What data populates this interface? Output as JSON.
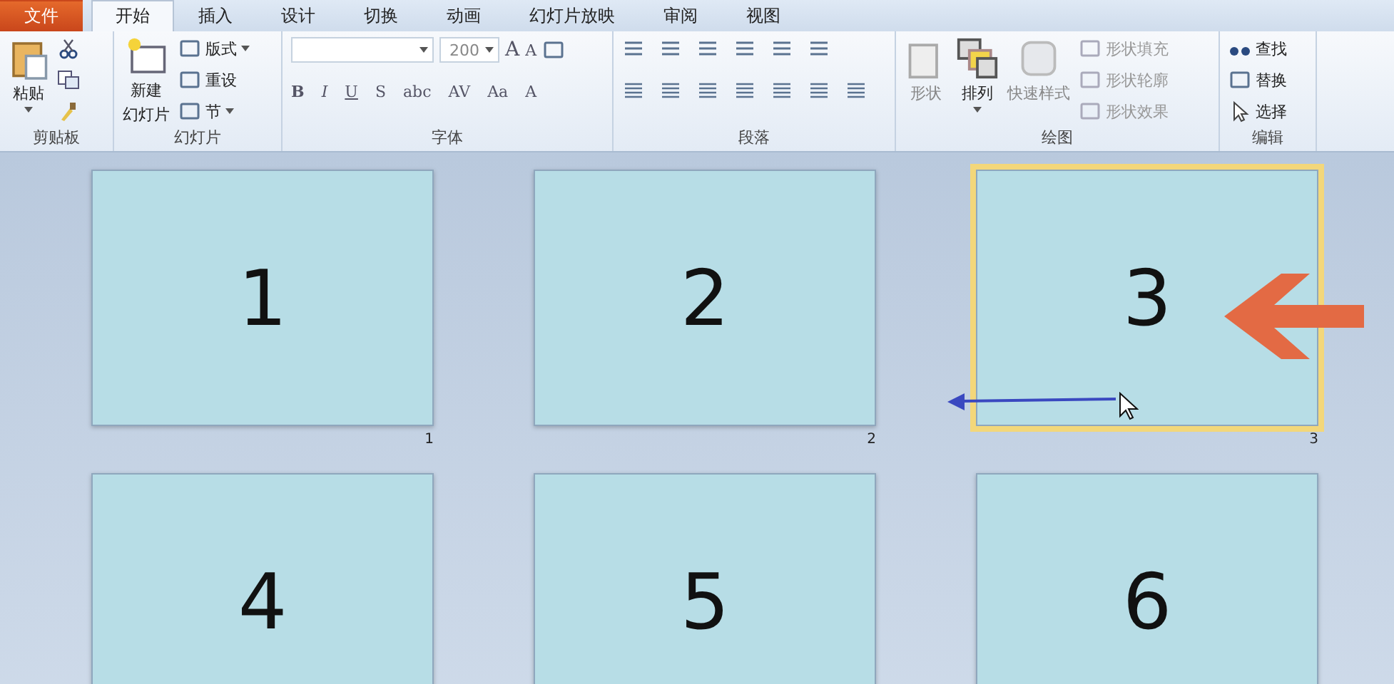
{
  "ribbon": {
    "tabs": [
      {
        "label": "文件",
        "kind": "file",
        "selected": false
      },
      {
        "label": "开始",
        "kind": "tab",
        "selected": true
      },
      {
        "label": "插入",
        "kind": "tab",
        "selected": false
      },
      {
        "label": "设计",
        "kind": "tab",
        "selected": false
      },
      {
        "label": "切换",
        "kind": "tab",
        "selected": false
      },
      {
        "label": "动画",
        "kind": "tab",
        "selected": false
      },
      {
        "label": "幻灯片放映",
        "kind": "tab",
        "selected": false
      },
      {
        "label": "审阅",
        "kind": "tab",
        "selected": false
      },
      {
        "label": "视图",
        "kind": "tab",
        "selected": false
      }
    ],
    "clipboard": {
      "paste": "粘贴",
      "group": "剪贴板"
    },
    "slides_group": {
      "new_slide": [
        "新建",
        "幻灯片"
      ],
      "layout": "版式",
      "reset": "重设",
      "section": "节",
      "group": "幻灯片"
    },
    "font": {
      "size": "200",
      "format": [
        "B",
        "I",
        "U",
        "S",
        "abc",
        "AV",
        "Aa",
        "A"
      ],
      "grow": "A",
      "shrink": "A",
      "group": "字体"
    },
    "paragraph": {
      "group": "段落"
    },
    "drawing": {
      "shapes": "形状",
      "arrange": "排列",
      "quick_styles": "快速样式",
      "fill": "形状填充",
      "outline": "形状轮廓",
      "effects": "形状效果",
      "group": "绘图"
    },
    "editing": {
      "find": "查找",
      "replace": "替换",
      "select": "选择",
      "group": "编辑"
    }
  },
  "slides": [
    {
      "title": "1",
      "number": "1",
      "selected": false
    },
    {
      "title": "2",
      "number": "2",
      "selected": false
    },
    {
      "title": "3",
      "number": "3",
      "selected": true
    },
    {
      "title": "4",
      "selected": false
    },
    {
      "title": "5",
      "selected": false
    },
    {
      "title": "6",
      "selected": false
    }
  ]
}
